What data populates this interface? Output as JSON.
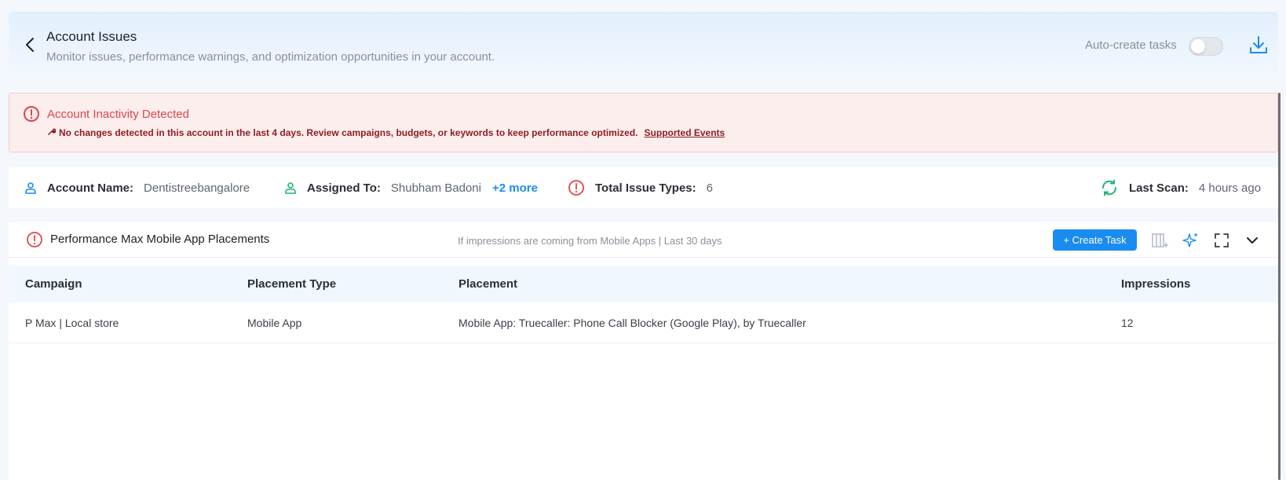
{
  "header": {
    "title": "Account Issues",
    "subtitle": "Monitor issues, performance warnings, and optimization opportunities in your account.",
    "auto_create_label": "Auto-create tasks",
    "auto_create_enabled": false
  },
  "alert": {
    "title": "Account Inactivity Detected",
    "message": "No changes detected in this account in the last 4 days. Review campaigns, budgets, or keywords to keep performance optimized.",
    "link": "Supported Events",
    "color": "#e0454a"
  },
  "info": {
    "account_label": "Account Name:",
    "account_value": "Dentistreebangalore",
    "assigned_label": "Assigned To:",
    "assigned_value": "Shubham Badoni",
    "assigned_more": "+2 more",
    "issues_label": "Total Issue Types:",
    "issues_value": "6",
    "scan_label": "Last Scan:",
    "scan_value": "4 hours ago"
  },
  "section": {
    "title": "Performance Max Mobile App Placements",
    "note": "If impressions are coming from Mobile Apps | Last 30 days",
    "create_task_label": "+ Create Task",
    "accent": "#1a8cf0"
  },
  "table": {
    "columns": [
      "Campaign",
      "Placement Type",
      "Placement",
      "Impressions"
    ],
    "rows": [
      [
        "P Max | Local store",
        "Mobile App",
        "Mobile App: Truecaller: Phone Call Blocker (Google Play), by Truecaller",
        "12"
      ]
    ]
  }
}
